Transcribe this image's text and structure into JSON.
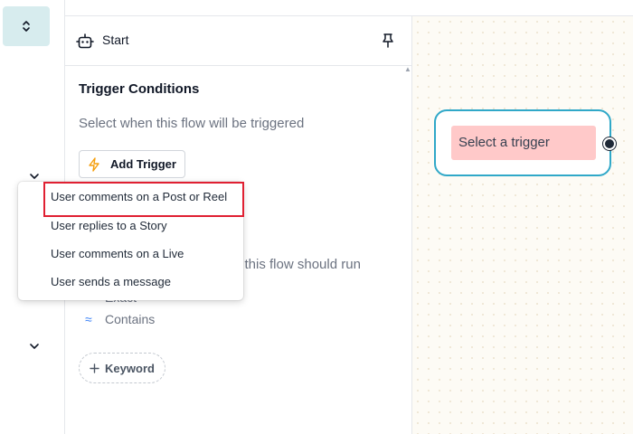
{
  "panel": {
    "title": "Start",
    "section_title": "Trigger Conditions",
    "section_subtitle": "Select when this flow will be triggered",
    "add_trigger_label": "Add Trigger",
    "partial_text": "n this flow should run",
    "match_options": [
      {
        "icon": "=",
        "label": "Exact"
      },
      {
        "icon": "≈",
        "label": "Contains"
      }
    ],
    "keyword_label": "Keyword"
  },
  "dropdown": {
    "items": [
      "User comments on a Post or Reel",
      "User replies to a Story",
      "User comments on a Live",
      "User sends a message"
    ],
    "highlighted_index": 0
  },
  "canvas": {
    "node_label": "Select a trigger"
  },
  "icons": {
    "rail_toggle": "chevron-up-down-icon",
    "rail_chevron": "chevron-down-icon",
    "header": "robot-icon",
    "pin": "pin-icon",
    "add_trigger": "lightning-icon",
    "keyword": "plus-icon"
  },
  "colors": {
    "accent_teal": "#30a8c8",
    "trigger_bg": "#ffc9c9",
    "highlight_border": "#e02032",
    "rail_active": "#d7ecee",
    "bolt": "#f59e0b"
  }
}
